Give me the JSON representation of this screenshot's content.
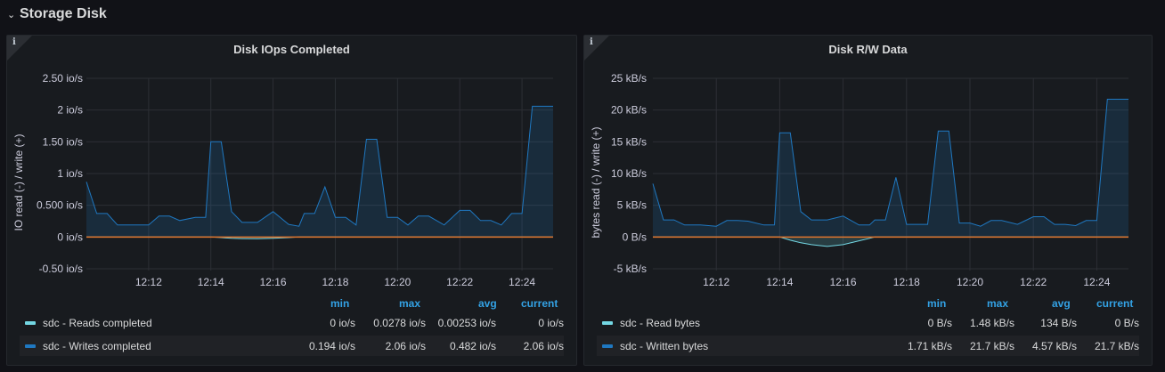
{
  "row": {
    "title": "Storage Disk",
    "chevron": "chevron-down-icon"
  },
  "panels": [
    {
      "title": "Disk IOps Completed",
      "info_icon": "info-icon",
      "ylabel": "IO read (-) / write (+)",
      "y_ticks": [
        "2.50 io/s",
        "2 io/s",
        "1.50 io/s",
        "1 io/s",
        "0.500 io/s",
        "0 io/s",
        "-0.50 io/s"
      ],
      "x_ticks": [
        "12:12",
        "12:14",
        "12:16",
        "12:18",
        "12:20",
        "12:22",
        "12:24"
      ],
      "legend_headers": [
        "min",
        "max",
        "avg",
        "current"
      ],
      "legend": [
        {
          "name": "sdc - Reads completed",
          "color": "#73d7e3",
          "min": "0 io/s",
          "max": "0.0278 io/s",
          "avg": "0.00253 io/s",
          "current": "0 io/s"
        },
        {
          "name": "sdc - Writes completed",
          "color": "#1f78c1",
          "min": "0.194 io/s",
          "max": "2.06 io/s",
          "avg": "0.482 io/s",
          "current": "2.06 io/s"
        }
      ]
    },
    {
      "title": "Disk R/W Data",
      "info_icon": "info-icon",
      "ylabel": "bytes read (-) / write (+)",
      "y_ticks": [
        "25 kB/s",
        "20 kB/s",
        "15 kB/s",
        "10 kB/s",
        "5 kB/s",
        "0 B/s",
        "-5 kB/s"
      ],
      "x_ticks": [
        "12:12",
        "12:14",
        "12:16",
        "12:18",
        "12:20",
        "12:22",
        "12:24"
      ],
      "legend_headers": [
        "min",
        "max",
        "avg",
        "current"
      ],
      "legend": [
        {
          "name": "sdc - Read bytes",
          "color": "#73d7e3",
          "min": "0 B/s",
          "max": "1.48 kB/s",
          "avg": "134 B/s",
          "current": "0 B/s"
        },
        {
          "name": "sdc - Written bytes",
          "color": "#1f78c1",
          "min": "1.71 kB/s",
          "max": "21.7 kB/s",
          "avg": "4.57 kB/s",
          "current": "21.7 kB/s"
        }
      ]
    }
  ],
  "chart_data": [
    {
      "type": "area",
      "title": "Disk IOps Completed",
      "ylabel": "IO read (-) / write (+)",
      "x_unit": "time (HH:MM)",
      "ylim": [
        -0.5,
        2.5
      ],
      "x": [
        "12:10",
        "12:10:20",
        "12:10:40",
        "12:11",
        "12:11:30",
        "12:12",
        "12:12:20",
        "12:12:40",
        "12:13",
        "12:13:30",
        "12:13:50",
        "12:14",
        "12:14:20",
        "12:14:40",
        "12:15",
        "12:15:30",
        "12:16",
        "12:16:30",
        "12:16:50",
        "12:17",
        "12:17:20",
        "12:17:40",
        "12:18",
        "12:18:20",
        "12:18:40",
        "12:19",
        "12:19:20",
        "12:19:40",
        "12:20",
        "12:20:20",
        "12:20:40",
        "12:21",
        "12:21:30",
        "12:22",
        "12:22:20",
        "12:22:40",
        "12:23",
        "12:23:20",
        "12:23:40",
        "12:24",
        "12:24:20",
        "12:24:40",
        "12:25"
      ],
      "series": [
        {
          "name": "sdc - Writes completed",
          "color": "#1f78c1",
          "values": [
            0.87,
            0.37,
            0.37,
            0.19,
            0.19,
            0.19,
            0.33,
            0.33,
            0.26,
            0.31,
            0.31,
            1.5,
            1.5,
            0.4,
            0.23,
            0.23,
            0.4,
            0.2,
            0.17,
            0.37,
            0.37,
            0.79,
            0.31,
            0.31,
            0.19,
            1.54,
            1.54,
            0.31,
            0.31,
            0.19,
            0.33,
            0.33,
            0.19,
            0.42,
            0.42,
            0.26,
            0.26,
            0.19,
            0.37,
            0.37,
            2.06,
            2.06,
            2.06
          ]
        },
        {
          "name": "sdc - Reads completed",
          "color": "#73d7e3",
          "values": [
            0,
            0,
            0,
            0,
            0,
            0,
            0,
            0,
            0,
            0,
            0,
            0,
            -0.01,
            -0.02,
            -0.025,
            -0.028,
            -0.02,
            -0.01,
            0,
            0,
            0,
            0,
            0,
            0,
            0,
            0,
            0,
            0,
            0,
            0,
            0,
            0,
            0,
            0,
            0,
            0,
            0,
            0,
            0,
            0,
            0,
            0,
            0
          ]
        }
      ]
    },
    {
      "type": "area",
      "title": "Disk R/W Data",
      "ylabel": "bytes read (-) / write (+)",
      "x_unit": "time (HH:MM)",
      "ylim": [
        -5,
        25
      ],
      "y_unit": "kB/s",
      "x": [
        "12:10",
        "12:10:20",
        "12:10:40",
        "12:11",
        "12:11:30",
        "12:12",
        "12:12:20",
        "12:12:40",
        "12:13",
        "12:13:30",
        "12:13:50",
        "12:14",
        "12:14:20",
        "12:14:40",
        "12:15",
        "12:15:30",
        "12:16",
        "12:16:30",
        "12:16:50",
        "12:17",
        "12:17:20",
        "12:17:40",
        "12:18",
        "12:18:20",
        "12:18:40",
        "12:19",
        "12:19:20",
        "12:19:40",
        "12:20",
        "12:20:20",
        "12:20:40",
        "12:21",
        "12:21:30",
        "12:22",
        "12:22:20",
        "12:22:40",
        "12:23",
        "12:23:20",
        "12:23:40",
        "12:24",
        "12:24:20",
        "12:24:40",
        "12:25"
      ],
      "series": [
        {
          "name": "sdc - Written bytes",
          "color": "#1f78c1",
          "values": [
            8.4,
            2.7,
            2.7,
            1.9,
            1.9,
            1.7,
            2.6,
            2.6,
            2.5,
            1.9,
            1.9,
            16.4,
            16.4,
            4.0,
            2.7,
            2.7,
            3.3,
            1.9,
            1.9,
            2.7,
            2.7,
            9.4,
            2.0,
            2.0,
            2.0,
            16.7,
            16.7,
            2.2,
            2.2,
            1.7,
            2.6,
            2.6,
            2.0,
            3.2,
            3.2,
            2.0,
            2.0,
            1.8,
            2.6,
            2.6,
            21.7,
            21.7,
            21.7
          ]
        },
        {
          "name": "sdc - Read bytes",
          "color": "#73d7e3",
          "values": [
            0,
            0,
            0,
            0,
            0,
            0,
            0,
            0,
            0,
            0,
            0,
            0,
            -0.5,
            -0.9,
            -1.2,
            -1.48,
            -1.2,
            -0.6,
            -0.2,
            0,
            0,
            0,
            0,
            0,
            0,
            0,
            0,
            0,
            0,
            0,
            0,
            0,
            0,
            0,
            0,
            0,
            0,
            0,
            0,
            0,
            0,
            0,
            0
          ]
        }
      ]
    }
  ]
}
